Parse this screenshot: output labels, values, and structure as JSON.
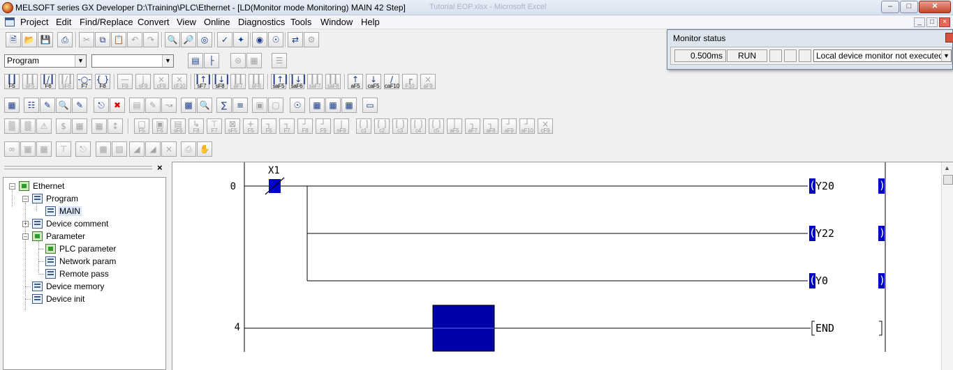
{
  "window": {
    "title": "MELSOFT series GX Developer D:\\Training\\PLC\\Ethernet - [LD(Monitor mode Monitoring)     MAIN     42 Step]",
    "ghost_text": "Tutorial EOP.xlsx - Microsoft Excel"
  },
  "menu": [
    "Project",
    "Edit",
    "Find/Replace",
    "Convert",
    "View",
    "Online",
    "Diagnostics",
    "Tools",
    "Window",
    "Help"
  ],
  "toolbar": {
    "data_type_select": "Program",
    "program_select": ""
  },
  "ladder_keys": [
    "F5",
    "sF5",
    "F6",
    "sF6",
    "F7",
    "F8",
    "F9",
    "sF9",
    "cF9",
    "cF10",
    "sF7",
    "sF8",
    "aF7",
    "aF8",
    "saF5",
    "saF6",
    "saF7",
    "saF8",
    "aF5",
    "caF5",
    "caF10",
    "F10",
    "aF9"
  ],
  "ladder_keys_row2": [
    "F5",
    "F6",
    "sF6",
    "F8",
    "F7",
    "sF5",
    "F5",
    "F6",
    "F7",
    "F8",
    "F9",
    "sF9",
    "c1",
    "c2",
    "c3",
    "c4",
    "c5",
    "aF5",
    "aF7",
    "aF8",
    "aF9",
    "aF10",
    "cF9"
  ],
  "monitor_status": {
    "title": "Monitor status",
    "scan_time": "0.500ms",
    "run_state": "RUN",
    "local_monitor": "Local device monitor not executed"
  },
  "project_tree": {
    "root": "Ethernet",
    "items": [
      {
        "label": "Ethernet"
      },
      {
        "label": "Program"
      },
      {
        "label": "MAIN"
      },
      {
        "label": "Device comment"
      },
      {
        "label": "Parameter"
      },
      {
        "label": "PLC parameter"
      },
      {
        "label": "Network param"
      },
      {
        "label": "Remote pass"
      },
      {
        "label": "Device memory"
      },
      {
        "label": "Device init"
      }
    ]
  },
  "ladder": {
    "contact_label": "X1",
    "step_labels": [
      "0",
      "4"
    ],
    "coils": [
      "Y20",
      "Y22",
      "Y0"
    ],
    "end_label": "END",
    "active_color": "#0000c8",
    "cursor_color": "#0000a8"
  }
}
